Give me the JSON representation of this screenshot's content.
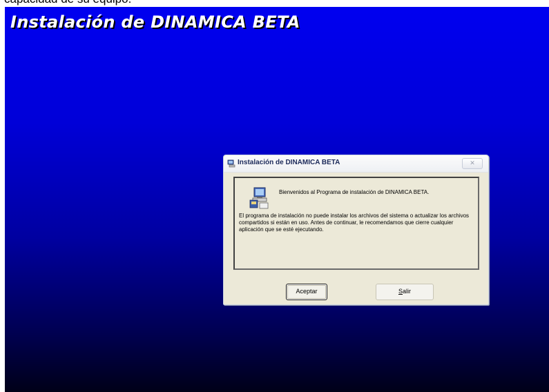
{
  "top_caption": "capacidad de su equipo.",
  "installer": {
    "title": "Instalación de DINAMICA BETA"
  },
  "dialog": {
    "title": "Instalación de DINAMICA BETA",
    "close_label": "✕",
    "welcome": "Bienvenidos al Programa de instalación de DINAMICA BETA.",
    "info": "El programa de instalación no puede instalar los archivos del sistema o actualizar los archivos compartidos si están en uso. Antes de continuar, le recomendamos que cierre cualquier aplicación que se esté ejecutando.",
    "buttons": {
      "accept": "Aceptar",
      "exit_accel": "S",
      "exit_rest": "alir"
    }
  },
  "colors": {
    "background_top": "#0000f0",
    "background_bottom": "#000018",
    "dialog_face": "#ece9d8"
  },
  "icons": {
    "titlebar": "setup-computer-icon",
    "content": "setup-computer-icon"
  }
}
